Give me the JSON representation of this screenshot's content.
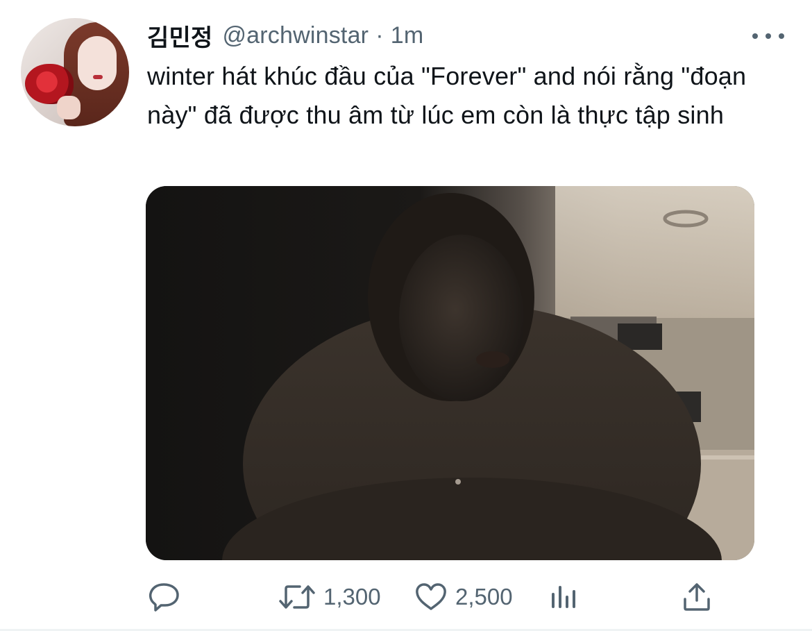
{
  "tweet": {
    "display_name": "김민정",
    "handle": "@archwinstar",
    "separator": "·",
    "time": "1m",
    "text": "winter hát khúc đầu của \"Forever\" and nói rằng \"đoạn này\" đã được thu âm từ lúc em còn là thực tập sinh",
    "avatar_icon": "profile-photo-woman-holding-rose",
    "more_icon": "more-horizontal-icon",
    "media": {
      "type": "video-frame",
      "subject": "person-in-dark-room"
    },
    "actions": {
      "reply": {
        "icon": "reply-icon"
      },
      "retweet": {
        "icon": "retweet-icon",
        "count": "1,300"
      },
      "like": {
        "icon": "heart-icon",
        "count": "2,500"
      },
      "analytics": {
        "icon": "analytics-icon"
      },
      "share": {
        "icon": "share-icon"
      }
    },
    "colors": {
      "text": "#0f1419",
      "secondary": "#536471",
      "background": "#ffffff"
    }
  }
}
